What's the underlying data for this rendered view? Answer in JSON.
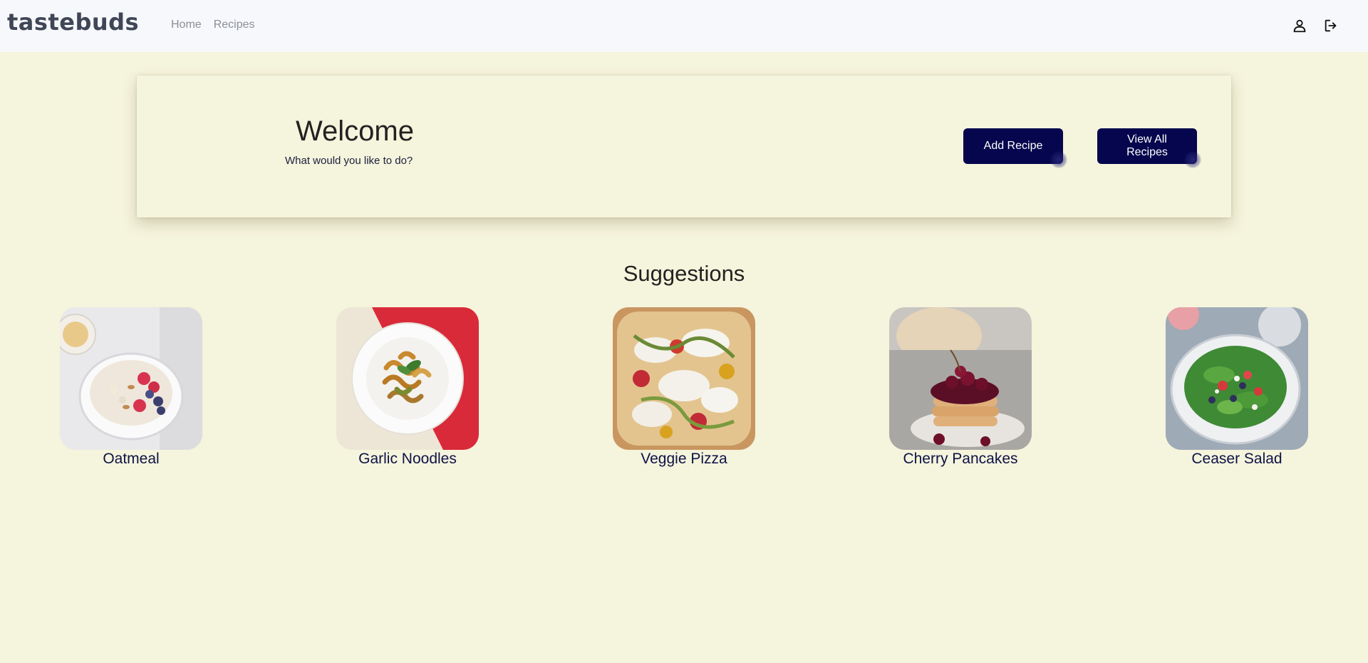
{
  "navbar": {
    "brand": "tastebuds",
    "links": [
      {
        "label": "Home"
      },
      {
        "label": "Recipes"
      }
    ],
    "icons": [
      "user-icon",
      "logout-icon"
    ]
  },
  "welcome": {
    "title": "Welcome",
    "subtitle": "What would you like to do?",
    "add_recipe_label": "Add Recipe",
    "view_all_label": "View All Recipes"
  },
  "suggestions": {
    "title": "Suggestions",
    "items": [
      {
        "name": "Oatmeal"
      },
      {
        "name": "Garlic Noodles"
      },
      {
        "name": "Veggie Pizza"
      },
      {
        "name": "Cherry Pancakes"
      },
      {
        "name": "Ceaser Salad"
      }
    ]
  },
  "colors": {
    "background": "#f5f4dc",
    "navbar": "#f7f8fb",
    "button": "#05064d",
    "brand": "#3f4757"
  }
}
